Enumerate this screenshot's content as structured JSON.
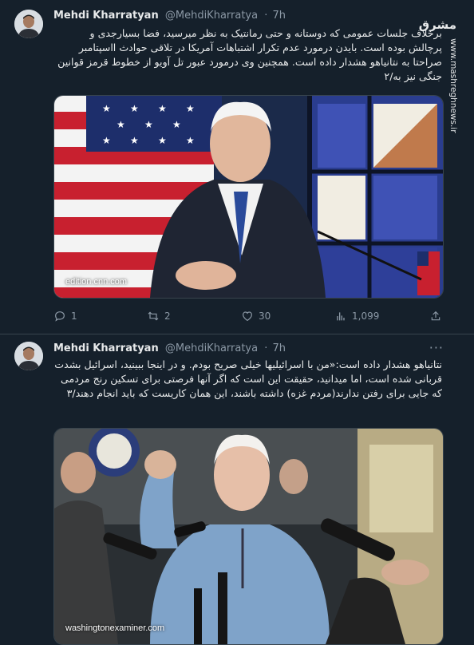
{
  "watermark": {
    "brand": "مشرق",
    "site": "www.mashreghnews.ir"
  },
  "tweets": [
    {
      "name": "Mehdi Kharratyan",
      "handle": "@MehdiKharratya",
      "dot": "·",
      "time": "7h",
      "text": "برخلاف جلسات عمومی که دوستانه و حتی رمانتیک به نظر میرسید، فضا بسیارجدی و پرچالش بوده است. بایدن درمورد عدم تکرار اشتباهات آمریکا در تلاقی حوادث ااسپتامبر صراحتا به نتانیاهو هشدار داده است. همچنین وی درمورد عبور تل آویو از خطوط قرمز قوانین جنگی نیز به/۲",
      "media_caption": "edition.cnn.com",
      "actions": {
        "replies": "1",
        "retweets": "2",
        "likes": "30",
        "views": "1,099"
      }
    },
    {
      "name": "Mehdi Kharratyan",
      "handle": "@MehdiKharratya",
      "dot": "·",
      "time": "7h",
      "more": "···",
      "text": "نتانیاهو هشدار داده است:«من با اسرائیلیها خیلی صریح بودم. و در اینجا ببینید، اسرائیل بشدت قربانی شده است، اما میدانید، حقیقت این است که اگر آنها فرصتی برای تسکین رنج مردمی که جایی برای رفتن ندارند(مردم غزه) داشته باشند، این همان کاریست که باید انجام دهند/۳",
      "media_caption": "washingtonexaminer.com"
    }
  ],
  "colors": {
    "background": "#15202b",
    "text": "#e7e9ea",
    "muted": "#8b98a5",
    "border": "#38444d"
  },
  "icons": [
    "reply-icon",
    "retweet-icon",
    "like-icon",
    "views-icon",
    "share-icon"
  ]
}
